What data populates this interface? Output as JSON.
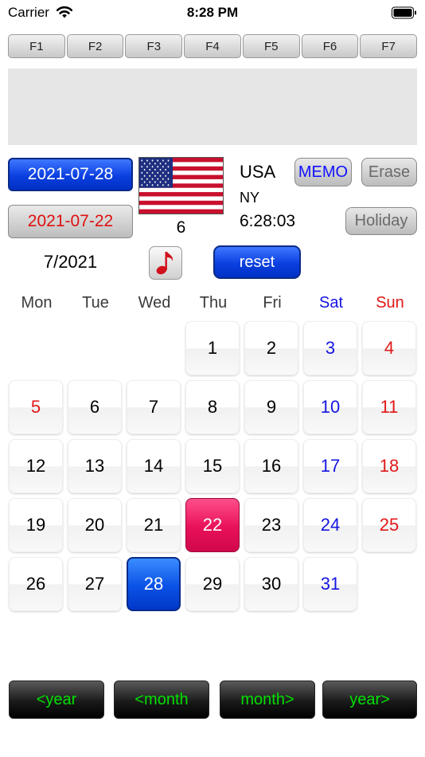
{
  "status": {
    "carrier": "Carrier",
    "time": "8:28 PM"
  },
  "fkeys": [
    "F1",
    "F2",
    "F3",
    "F4",
    "F5",
    "F6",
    "F7"
  ],
  "dates": {
    "today": "2021-07-28",
    "selected": "2021-07-22"
  },
  "location": {
    "country": "USA",
    "region": "NY",
    "time": "6:28:03",
    "week": "6"
  },
  "buttons": {
    "memo": "MEMO",
    "erase": "Erase",
    "holiday": "Holiday",
    "reset": "reset"
  },
  "month_label": "7/2021",
  "weekdays": [
    "Mon",
    "Tue",
    "Wed",
    "Thu",
    "Fri",
    "Sat",
    "Sun"
  ],
  "days": {
    "d1": "1",
    "d2": "2",
    "d3": "3",
    "d4": "4",
    "d5": "5",
    "d6": "6",
    "d7": "7",
    "d8": "8",
    "d9": "9",
    "d10": "10",
    "d11": "11",
    "d12": "12",
    "d13": "13",
    "d14": "14",
    "d15": "15",
    "d16": "16",
    "d17": "17",
    "d18": "18",
    "d19": "19",
    "d20": "20",
    "d21": "21",
    "d22": "22",
    "d23": "23",
    "d24": "24",
    "d25": "25",
    "d26": "26",
    "d27": "27",
    "d28": "28",
    "d29": "29",
    "d30": "30",
    "d31": "31"
  },
  "nav": {
    "prev_year": "<year",
    "prev_month": "<month",
    "next_month": "month>",
    "next_year": "year>"
  },
  "colors": {
    "weekend_sat": "#1515e0",
    "weekend_sun": "#e01818",
    "today": "#0a52e6",
    "selected": "#e8105a",
    "nav_text": "#00e000"
  },
  "icons": {
    "music": "music-note-icon",
    "flag": "us-flag-icon",
    "wifi": "wifi-icon",
    "battery": "battery-icon"
  }
}
